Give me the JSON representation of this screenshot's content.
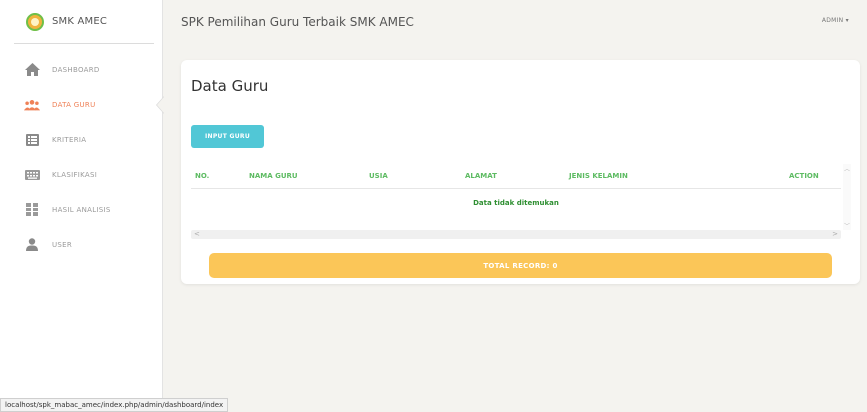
{
  "brand": {
    "name": "SMK AMEC"
  },
  "sidebar": {
    "items": [
      {
        "label": "DASHBOARD",
        "icon": "home-icon"
      },
      {
        "label": "DATA GURU",
        "icon": "users-icon",
        "active": true
      },
      {
        "label": "KRITERIA",
        "icon": "list-icon"
      },
      {
        "label": "KLASIFIKASI",
        "icon": "keyboard-icon"
      },
      {
        "label": "HASIL ANALISIS",
        "icon": "grid-icon"
      },
      {
        "label": "USER",
        "icon": "user-icon"
      }
    ]
  },
  "header": {
    "title": "SPK Pemilihan Guru Terbaik SMK AMEC",
    "user_menu": "ADMIN ▾"
  },
  "main": {
    "title": "Data Guru",
    "input_button": "INPUT GURU",
    "table": {
      "columns": [
        "NO.",
        "NAMA GURU",
        "USIA",
        "ALAMAT",
        "JENIS KELAMIN",
        "ACTION"
      ],
      "empty_message": "Data tidak ditemukan"
    },
    "total_record": "TOTAL RECORD: 0"
  },
  "statusbar": {
    "url": "localhost/spk_mabac_amec/index.php/admin/dashboard/index"
  },
  "colors": {
    "accent_orange": "#ef8157",
    "header_green": "#5dbb62",
    "button_cyan": "#51c7d6",
    "total_yellow": "#fbc658"
  }
}
